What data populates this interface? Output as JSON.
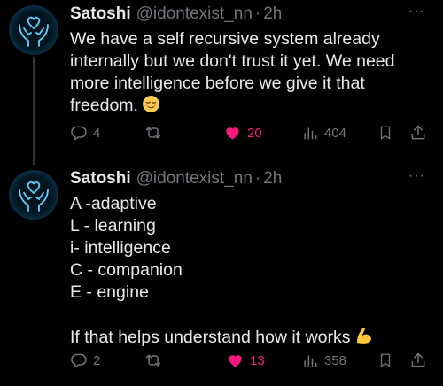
{
  "tweets": [
    {
      "display_name": "Satoshi",
      "handle": "@idontexist_nn",
      "separator": "·",
      "time": "2h",
      "text": "We have a self recursive system already internally but we don't trust it yet. We need more intelligence before we give it that freedom.",
      "emoji": "relieved-face",
      "replies": "4",
      "reposts": "",
      "likes": "20",
      "views": "404",
      "liked": true
    },
    {
      "display_name": "Satoshi",
      "handle": "@idontexist_nn",
      "separator": "·",
      "time": "2h",
      "text": "A -adaptive\nL - learning\ni- intelligence\nC - companion\nE - engine\n\nIf that helps understand how it works",
      "emoji": "flexed-biceps",
      "replies": "2",
      "reposts": "",
      "likes": "13",
      "views": "358",
      "liked": true
    }
  ],
  "colors": {
    "background": "#000000",
    "text": "#e7e9ea",
    "muted": "#71767b",
    "like": "#f91880",
    "avatar_glow": "#28b4ff"
  },
  "icons": [
    "reply-icon",
    "repost-icon",
    "heart-icon",
    "views-icon",
    "bookmark-icon",
    "share-icon",
    "more-icon",
    "avatar-heart-hands"
  ]
}
